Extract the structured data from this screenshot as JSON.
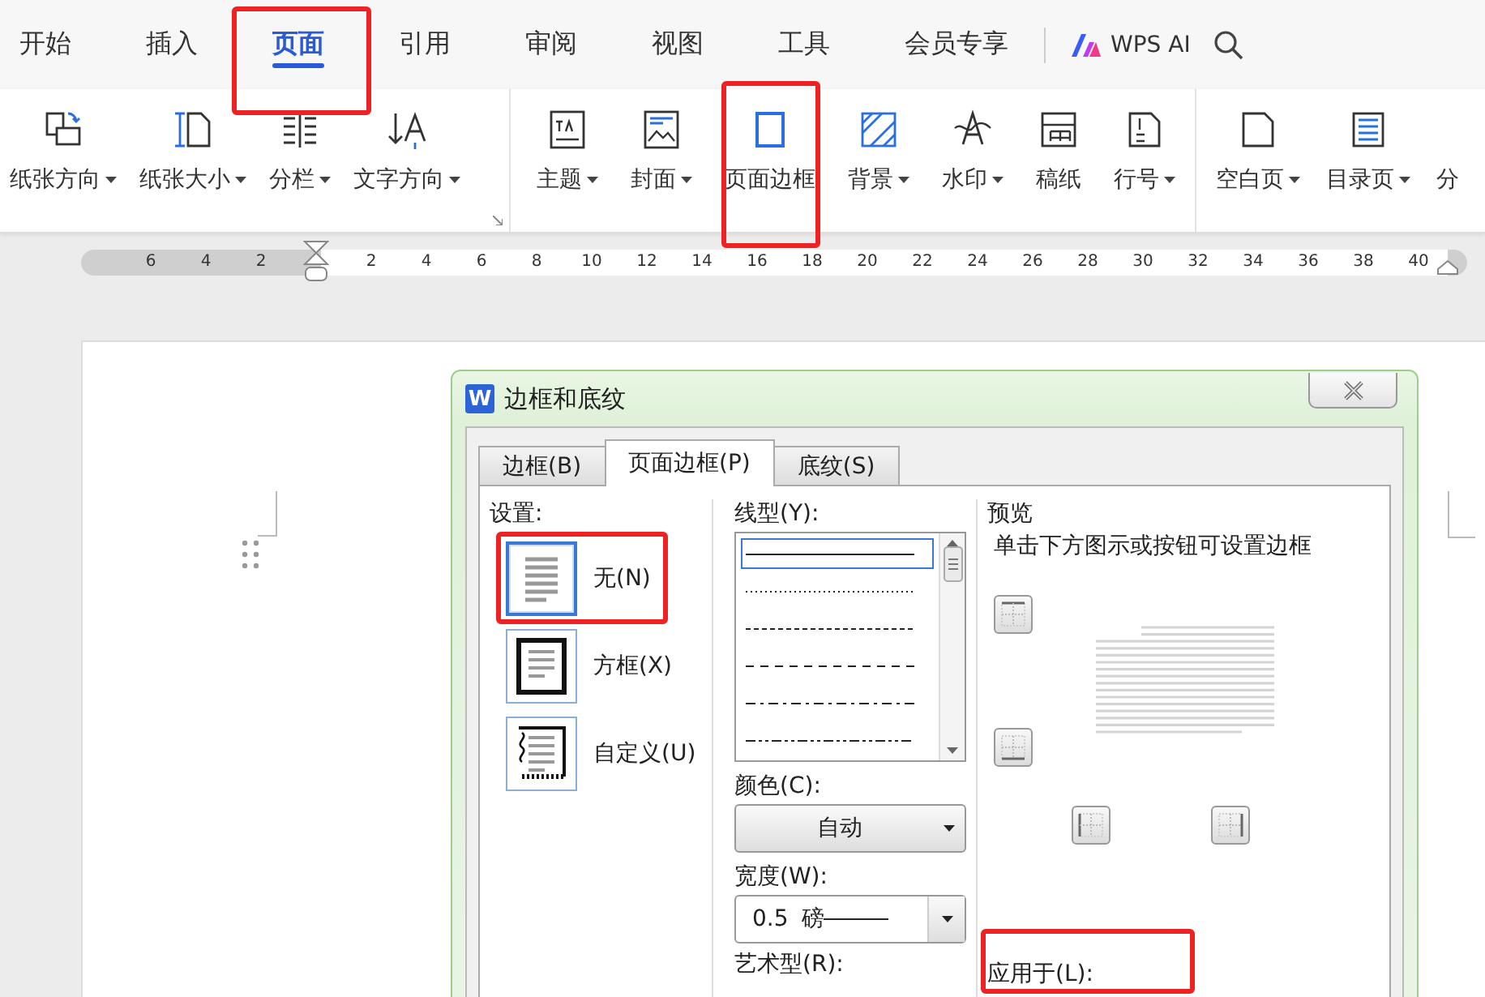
{
  "menu_tabs": [
    {
      "label": "开始",
      "selected": false
    },
    {
      "label": "插入",
      "selected": false
    },
    {
      "label": "页面",
      "selected": true
    },
    {
      "label": "引用",
      "selected": false
    },
    {
      "label": "审阅",
      "selected": false
    },
    {
      "label": "视图",
      "selected": false
    },
    {
      "label": "工具",
      "selected": false
    },
    {
      "label": "会员专享",
      "selected": false
    }
  ],
  "ai_button": {
    "label": "WPS AI"
  },
  "ribbon_groups": [
    [
      {
        "label": "纸张方向",
        "has_menu": true
      },
      {
        "label": "纸张大小",
        "has_menu": true
      },
      {
        "label": "分栏",
        "has_menu": true
      },
      {
        "label": "文字方向",
        "has_menu": true
      }
    ],
    [
      {
        "label": "主题",
        "has_menu": true
      },
      {
        "label": "封面",
        "has_menu": true
      },
      {
        "label": "页面边框",
        "has_menu": false
      },
      {
        "label": "背景",
        "has_menu": true
      },
      {
        "label": "水印",
        "has_menu": true
      },
      {
        "label": "稿纸",
        "has_menu": false
      },
      {
        "label": "行号",
        "has_menu": true
      }
    ],
    [
      {
        "label": "空白页",
        "has_menu": true
      },
      {
        "label": "目录页",
        "has_menu": true
      },
      {
        "label": "分",
        "has_menu": false
      }
    ]
  ],
  "ruler": {
    "left_ticks": [
      "6",
      "4",
      "2"
    ],
    "right_ticks": [
      "2",
      "4",
      "6",
      "8",
      "10",
      "12",
      "14",
      "16",
      "18",
      "20",
      "22",
      "24",
      "26",
      "28",
      "30",
      "32",
      "34",
      "36",
      "38",
      "40"
    ]
  },
  "dialog": {
    "title": "边框和底纹",
    "icon_text": "W",
    "tabs": [
      {
        "label": "边框(B)",
        "selected": false
      },
      {
        "label": "页面边框(P)",
        "selected": true
      },
      {
        "label": "底纹(S)",
        "selected": false
      }
    ],
    "settings": {
      "label": "设置:",
      "options": [
        {
          "label": "无(N)",
          "kind": "none",
          "selected": true
        },
        {
          "label": "方框(X)",
          "kind": "box",
          "selected": false
        },
        {
          "label": "自定义(U)",
          "kind": "custom",
          "selected": false
        }
      ]
    },
    "line_style": {
      "label": "线型(Y):",
      "options": [
        {
          "kind": "solid",
          "selected": true
        },
        {
          "kind": "dotted",
          "selected": false
        },
        {
          "kind": "dashed",
          "selected": false
        },
        {
          "kind": "long-dash",
          "selected": false
        },
        {
          "kind": "dash-dot",
          "selected": false
        },
        {
          "kind": "dash-dot-dot",
          "selected": false
        }
      ]
    },
    "color": {
      "label": "颜色(C):",
      "value": "自动"
    },
    "width": {
      "label": "宽度(W):",
      "value": "0.5",
      "unit": "磅"
    },
    "art": {
      "label": "艺术型(R):"
    },
    "preview": {
      "label": "预览",
      "hint": "单击下方图示或按钮可设置边框"
    },
    "apply_to": {
      "label": "应用于(L):"
    }
  }
}
